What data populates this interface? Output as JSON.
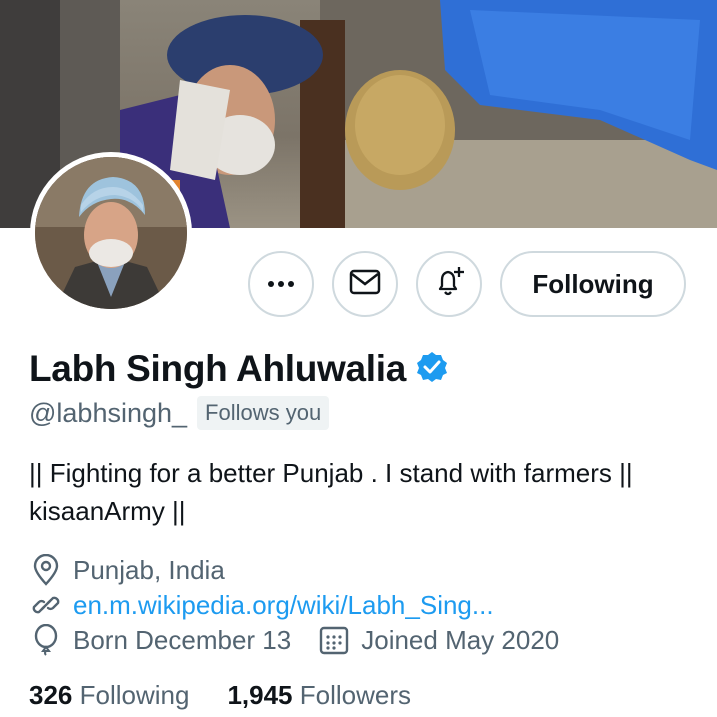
{
  "profile": {
    "display_name": "Labh Singh Ahluwalia",
    "handle": "@labhsingh_",
    "follows_you": "Follows you",
    "verified": true,
    "bio": "|| Fighting for a better Punjab . I stand with farmers || kisaanArmy ||",
    "location": "Punjab, India",
    "website": "en.m.wikipedia.org/wiki/Labh_Sing...",
    "birthday": "Born December 13",
    "joined": "Joined May 2020"
  },
  "actions": {
    "more_icon": "more-icon",
    "message_icon": "mail-icon",
    "notify_icon": "bell-plus-icon",
    "following_label": "Following"
  },
  "stats": {
    "following_count": "326",
    "following_label": "Following",
    "followers_count": "1,945",
    "followers_label": "Followers"
  },
  "colors": {
    "accent": "#1d9bf0",
    "muted": "#536471",
    "border": "#cfd9de"
  }
}
